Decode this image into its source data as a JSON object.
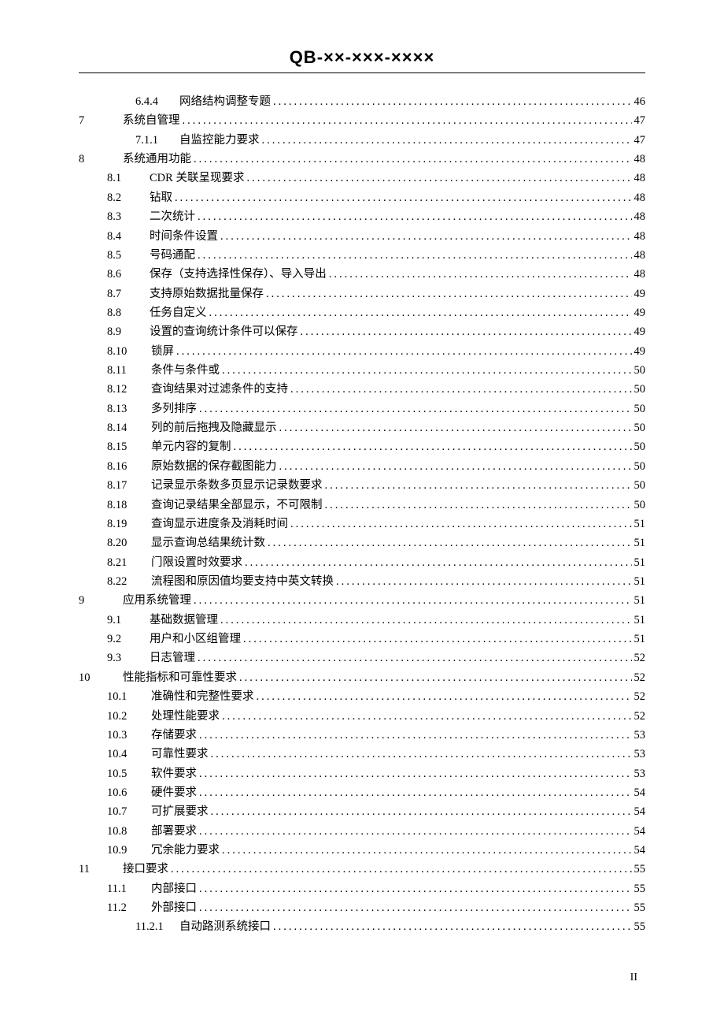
{
  "header": "QB-××-×××-××××",
  "footer": "II",
  "toc": [
    {
      "level": 2,
      "num": "6.4.4",
      "title": "网络结构调整专题",
      "page": "46"
    },
    {
      "level": 0,
      "num": "7",
      "title": "系统自管理",
      "page": "47"
    },
    {
      "level": 2,
      "num": "7.1.1",
      "title": "自监控能力要求",
      "page": "47"
    },
    {
      "level": 0,
      "num": "8",
      "title": "系统通用功能",
      "page": "48"
    },
    {
      "level": 1,
      "num": "8.1",
      "title": "CDR 关联呈现要求",
      "page": "48"
    },
    {
      "level": 1,
      "num": "8.2",
      "title": "钻取",
      "page": "48"
    },
    {
      "level": 1,
      "num": "8.3",
      "title": "二次统计",
      "page": "48"
    },
    {
      "level": 1,
      "num": "8.4",
      "title": "时间条件设置",
      "page": "48"
    },
    {
      "level": 1,
      "num": "8.5",
      "title": "号码通配",
      "page": "48"
    },
    {
      "level": 1,
      "num": "8.6",
      "title": "保存（支持选择性保存）、导入导出",
      "page": "48"
    },
    {
      "level": 1,
      "num": "8.7",
      "title": "支持原始数据批量保存",
      "page": "49"
    },
    {
      "level": 1,
      "num": "8.8",
      "title": "任务自定义",
      "page": "49"
    },
    {
      "level": 1,
      "num": "8.9",
      "title": "设置的查询统计条件可以保存",
      "page": "49"
    },
    {
      "level": 1,
      "num": "8.10",
      "title": "锁屏",
      "page": "49"
    },
    {
      "level": 1,
      "num": "8.11",
      "title": "条件与条件或",
      "page": "50"
    },
    {
      "level": 1,
      "num": "8.12",
      "title": "查询结果对过滤条件的支持",
      "page": "50"
    },
    {
      "level": 1,
      "num": "8.13",
      "title": "多列排序",
      "page": "50"
    },
    {
      "level": 1,
      "num": "8.14",
      "title": "列的前后拖拽及隐藏显示",
      "page": "50"
    },
    {
      "level": 1,
      "num": "8.15",
      "title": "单元内容的复制",
      "page": "50"
    },
    {
      "level": 1,
      "num": "8.16",
      "title": "原始数据的保存截图能力",
      "page": "50"
    },
    {
      "level": 1,
      "num": "8.17",
      "title": "记录显示条数多页显示记录数要求",
      "page": "50"
    },
    {
      "level": 1,
      "num": "8.18",
      "title": "查询记录结果全部显示，不可限制",
      "page": "50"
    },
    {
      "level": 1,
      "num": "8.19",
      "title": "查询显示进度条及消耗时间",
      "page": "51"
    },
    {
      "level": 1,
      "num": "8.20",
      "title": "显示查询总结果统计数",
      "page": "51"
    },
    {
      "level": 1,
      "num": "8.21",
      "title": "门限设置时效要求",
      "page": "51"
    },
    {
      "level": 1,
      "num": "8.22",
      "title": "流程图和原因值均要支持中英文转换",
      "page": "51"
    },
    {
      "level": 0,
      "num": "9",
      "title": "应用系统管理",
      "page": "51"
    },
    {
      "level": 1,
      "num": "9.1",
      "title": "基础数据管理",
      "page": "51"
    },
    {
      "level": 1,
      "num": "9.2",
      "title": "用户和小区组管理",
      "page": "51"
    },
    {
      "level": 1,
      "num": "9.3",
      "title": "日志管理",
      "page": "52"
    },
    {
      "level": 0,
      "num": "10",
      "title": "性能指标和可靠性要求",
      "page": "52",
      "chapIndent": 1
    },
    {
      "level": 1,
      "num": "10.1",
      "title": "准确性和完整性要求",
      "page": "52"
    },
    {
      "level": 1,
      "num": "10.2",
      "title": "处理性能要求",
      "page": "52"
    },
    {
      "level": 1,
      "num": "10.3",
      "title": "存储要求",
      "page": "53"
    },
    {
      "level": 1,
      "num": "10.4",
      "title": "可靠性要求",
      "page": "53"
    },
    {
      "level": 1,
      "num": "10.5",
      "title": "软件要求",
      "page": "53"
    },
    {
      "level": 1,
      "num": "10.6",
      "title": "硬件要求",
      "page": "54"
    },
    {
      "level": 1,
      "num": "10.7",
      "title": "可扩展要求",
      "page": "54"
    },
    {
      "level": 1,
      "num": "10.8",
      "title": "部署要求",
      "page": "54"
    },
    {
      "level": 1,
      "num": "10.9",
      "title": "冗余能力要求",
      "page": "54"
    },
    {
      "level": 0,
      "num": "11",
      "title": "接口要求",
      "page": "55",
      "chapIndent": 1
    },
    {
      "level": 1,
      "num": "11.1",
      "title": "内部接口",
      "page": "55"
    },
    {
      "level": 1,
      "num": "11.2",
      "title": "外部接口",
      "page": "55"
    },
    {
      "level": 2,
      "num": "11.2.1",
      "title": "自动路测系统接口",
      "page": "55"
    }
  ]
}
